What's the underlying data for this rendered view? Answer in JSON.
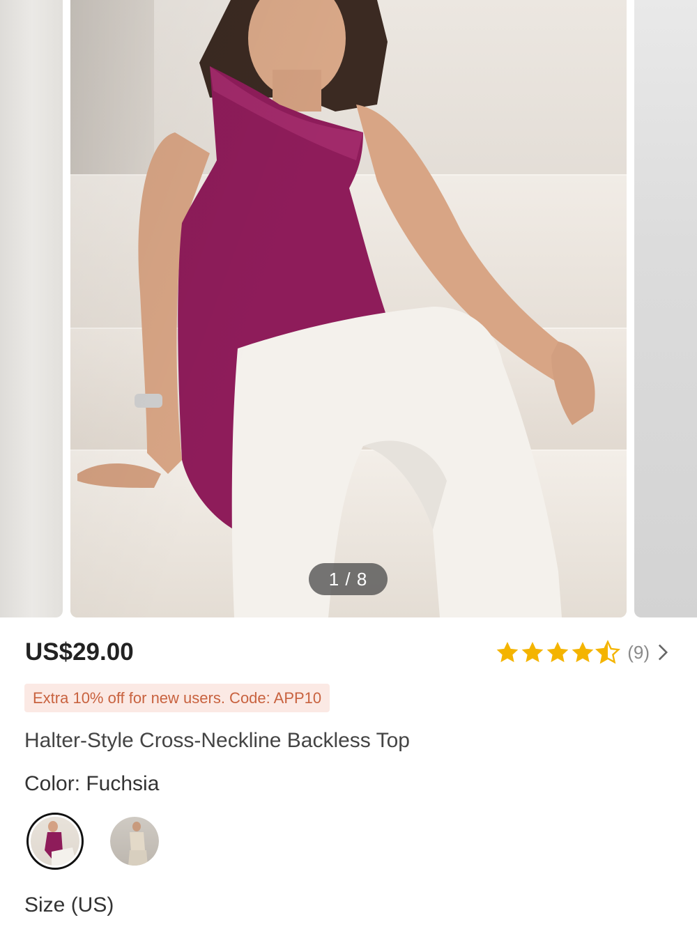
{
  "gallery": {
    "pager": "1 / 8"
  },
  "product": {
    "price": "US$29.00",
    "rating": {
      "stars": 4.5,
      "review_count": "(9)",
      "chevron_icon": "chevron-right-icon",
      "star_color": "#F4B400"
    },
    "promo": "Extra 10% off for new users. Code: APP10",
    "title": "Halter-Style Cross-Neckline Backless Top",
    "color_label": "Color: Fuchsia",
    "size_label": "Size (US)"
  },
  "colors": {
    "fuchsia": "#8E1C5A",
    "promo_bg": "#FBE9E4",
    "promo_text": "#C8623F"
  }
}
